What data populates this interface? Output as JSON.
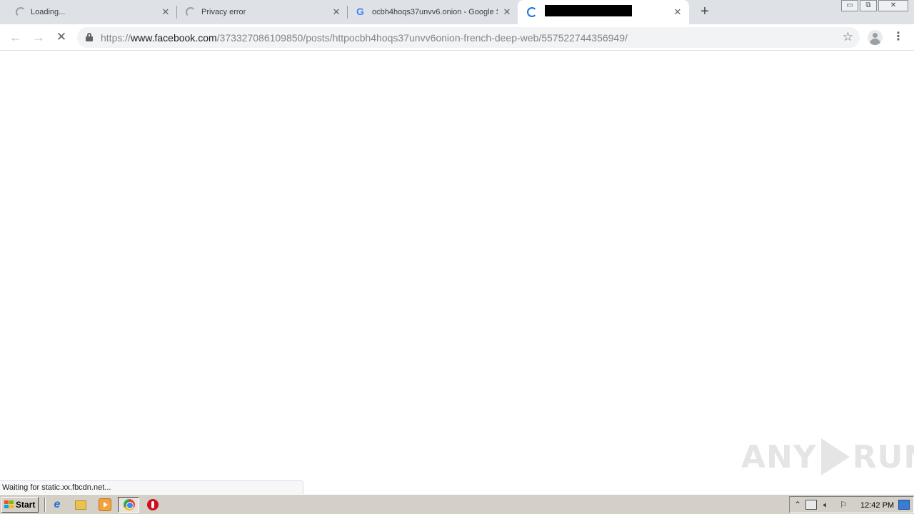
{
  "tabs": [
    {
      "title": "Loading...",
      "state": "loading"
    },
    {
      "title": "Privacy error",
      "state": "loading"
    },
    {
      "title": "ocbh4hoqs37unvv6.onion - Google S",
      "state": "loaded",
      "favicon": "google-icon"
    },
    {
      "title": "",
      "state": "loading-active",
      "redacted": true
    }
  ],
  "new_tab_glyph": "+",
  "window_controls": {
    "minimize": "▭",
    "restore": "⧉",
    "close": "✕"
  },
  "toolbar": {
    "back_glyph": "←",
    "forward_glyph": "→",
    "stop_glyph": "✕",
    "url_scheme": "https://",
    "url_host": "www.facebook.com",
    "url_path": "/373327086109850/posts/httpocbh4hoqs37unvv6onion-french-deep-web/557522744356949/",
    "bookmark_glyph": "☆",
    "menu_glyph": "⋮"
  },
  "status_bar": {
    "text": "Waiting for static.xx.fbcdn.net..."
  },
  "watermark": {
    "left": "ANY",
    "right": "RUN"
  },
  "taskbar": {
    "start_label": "Start",
    "apps": [
      "internet-explorer-icon",
      "folder-icon",
      "media-player-icon",
      "chrome-icon",
      "opera-icon"
    ],
    "clock": "12:42 PM"
  },
  "colors": {
    "tab_strip": "#dee1e6",
    "active_tab": "#ffffff",
    "omnibox": "#f1f3f4",
    "loading_blue": "#1a73e8",
    "taskbar": "#d4d0c8"
  }
}
